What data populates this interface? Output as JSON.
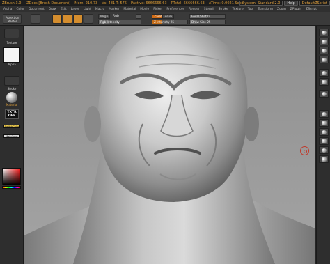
{
  "titlebar": {
    "app_title": "ZBrush 3.0",
    "doc_title": "ZDocs [Brush Document]",
    "mem": "Mem: 210.73",
    "stats_1": "Vs: 481 T: 576",
    "stats_2": "PActive: 6666666.63",
    "stats_3": "PTotal: 6666666.63",
    "stats_4": "ATime: 0.0021 Secs",
    "system_btn": "System: Standard 2.0",
    "help_btn": "Help",
    "script_btn": "DefaultZScript"
  },
  "menubar": {
    "items": [
      "Alpha",
      "Color",
      "Document",
      "Draw",
      "Edit",
      "Layer",
      "Light",
      "Macro",
      "Marker",
      "Material",
      "Movie",
      "Picker",
      "Preferences",
      "Render",
      "Stencil",
      "Stroke",
      "Texture",
      "Tool",
      "Transform",
      "Zoom",
      "ZPlugin",
      "ZScript"
    ]
  },
  "toolbar": {
    "projection_master": "Projection Master",
    "tool_labels": [
      "Edit",
      "Draw",
      "Move",
      "Scale",
      "Rotate"
    ],
    "rgb_label": "Rgb",
    "rgb_intensity": "Rgb Intensity",
    "mrgb_label": "Mrgb",
    "zadd": "Zadd",
    "zsub": "Zsub",
    "z_intensity": "Z Intensity 25",
    "focal_shift": "Focal Shift 0",
    "draw_size": "Draw Size 25",
    "rgb_value": 25,
    "z_intensity_value": 0.25,
    "focal_value": 0.5,
    "draw_size_value": 0.2
  },
  "leftshelf": {
    "alpha_label": "Alpha",
    "texture_label": "Texture",
    "material_label": "Material",
    "txtr_off": "TXTR OFF",
    "switch_label": "SwitchColor",
    "main_label": "MainColor",
    "stroke_label": "Stroke"
  },
  "colors": {
    "accent": "#d48d2e",
    "orange_active": "#cf6b15",
    "canvas_bg": "#9a9a9a"
  },
  "rightshelf": {
    "icons": [
      "bpr-icon",
      "scroll-icon",
      "zoom-icon",
      "actual-icon",
      "aahalf-icon",
      "persp-icon",
      "floor-icon",
      "local-icon",
      "xyz-icon",
      "frame-icon",
      "move-icon",
      "scale-icon",
      "rotate-icon",
      "polyf-icon"
    ]
  }
}
